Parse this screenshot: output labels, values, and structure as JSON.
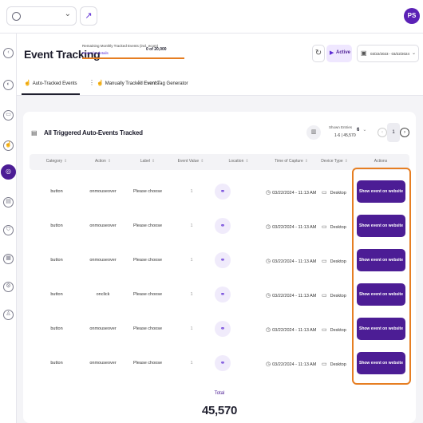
{
  "topbar": {
    "avatar_initials": "PS"
  },
  "header": {
    "title": "Event Tracking",
    "quota_label": "Remaining Monthly Tracked Events (incl. ecom)",
    "quota_value": "0 of 20,000",
    "quota_link": "Hover for details",
    "status_label": "Active",
    "date_range": "03/22/2023 - 03/22/2024"
  },
  "tabs": [
    {
      "label": "Auto-Tracked Events",
      "active": true
    },
    {
      "label": "Manually Tracked Events",
      "active": false
    },
    {
      "label": "Event Tag Generator",
      "active": false
    }
  ],
  "table": {
    "title": "All Triggered Auto-Events Tracked",
    "entries_label": "Shown Entries",
    "entries_range": "1-6 | 45,570",
    "entries_per_page": "6",
    "current_page": "1",
    "columns": [
      "Category",
      "Action",
      "Label",
      "Event Value",
      "Location",
      "Time of Capture",
      "Device Type",
      "Actions"
    ],
    "rows": [
      {
        "category": "button",
        "action": "onmouseover",
        "label": "Please choose",
        "value": "1",
        "time": "03/22/2024 - 11:13 AM",
        "device": "Desktop",
        "action_button": "Show event on website"
      },
      {
        "category": "button",
        "action": "onmouseover",
        "label": "Please choose",
        "value": "1",
        "time": "03/22/2024 - 11:13 AM",
        "device": "Desktop",
        "action_button": "Show event on website"
      },
      {
        "category": "button",
        "action": "onmouseover",
        "label": "Please choose",
        "value": "1",
        "time": "03/22/2024 - 11:13 AM",
        "device": "Desktop",
        "action_button": "Show event on website"
      },
      {
        "category": "button",
        "action": "onclick",
        "label": "Please choose",
        "value": "1",
        "time": "03/22/2024 - 11:13 AM",
        "device": "Desktop",
        "action_button": "Show event on website"
      },
      {
        "category": "button",
        "action": "onmouseover",
        "label": "Please choose",
        "value": "1",
        "time": "03/22/2024 - 11:13 AM",
        "device": "Desktop",
        "action_button": "Show event on website"
      },
      {
        "category": "button",
        "action": "onmouseover",
        "label": "Please choose",
        "value": "1",
        "time": "03/22/2024 - 11:13 AM",
        "device": "Desktop",
        "action_button": "Show event on website"
      }
    ],
    "total_label": "Total",
    "total_value": "45,570"
  },
  "colors": {
    "brand": "#4c1d95",
    "highlight": "#e67e22"
  }
}
